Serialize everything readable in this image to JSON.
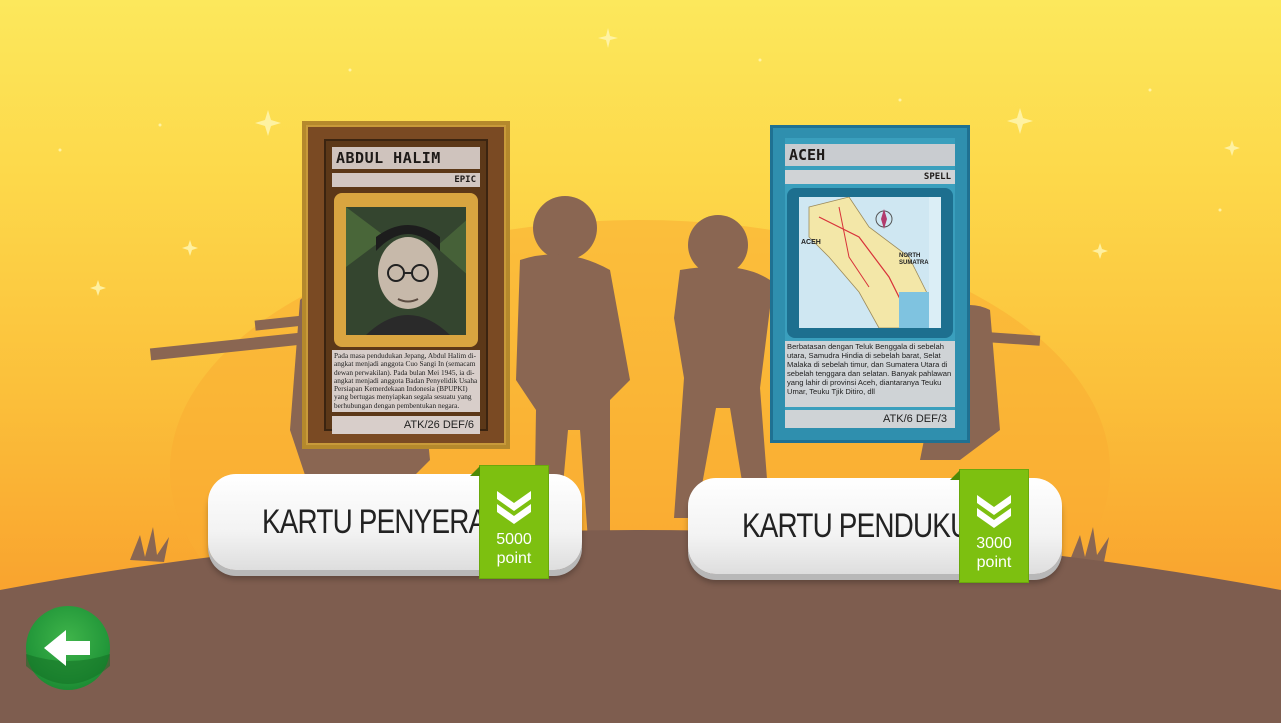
{
  "scene": "card-shop",
  "colors": {
    "sky_top": "#fce85c",
    "sky_bottom": "#f8992c",
    "ground": "#7e5d4f",
    "silhouette": "#8a6652",
    "price_green": "#7dc010",
    "back_green": "#23983a"
  },
  "hero_card": {
    "name": "ABDUL HALIM",
    "rarity": "EPIC",
    "portrait_icon": "portrait-abdul-halim",
    "description": "Pada masa pendudukan Jepang, Abdul Halim di-angkat menjadi anggota Cuo Sangi In (semacam dewan perwakilan). Pada bulan Mei 1945, ia di-angkat menjadi anggota Badan Penyelidik Usaha Persiapan Kemerdekaan Indonesia (BPUPKI) yang bertugas menyiapkan segala sesuatu yang berhubungan dengan pembentukan negara.",
    "stats": "ATK/26   DEF/6"
  },
  "spell_card": {
    "name": "ACEH",
    "rarity": "SPELL",
    "map_labels": [
      "ACEH",
      "NORTH SUMATRA"
    ],
    "description": "Berbatasan dengan Teluk Benggala di sebelah utara, Samudra Hindia di sebelah barat, Selat Malaka di sebelah timur, dan Sumatera Utara di sebelah tenggara dan selatan. Banyak pahlawan yang lahir di provinsi Aceh, diantaranya Teuku Umar, Teuku Tjik Ditiro, dll",
    "stats": "ATK/6   DEF/3"
  },
  "buy_attacker": {
    "label": "KARTU PENYERANG",
    "price_amount": "5000",
    "price_unit": "point",
    "icon": "double-chevron-down-icon"
  },
  "buy_supporter": {
    "label": "KARTU PENDUKUNG",
    "price_amount": "3000",
    "price_unit": "point",
    "icon": "double-chevron-down-icon"
  },
  "back_button": {
    "icon": "back-arrow-icon"
  }
}
